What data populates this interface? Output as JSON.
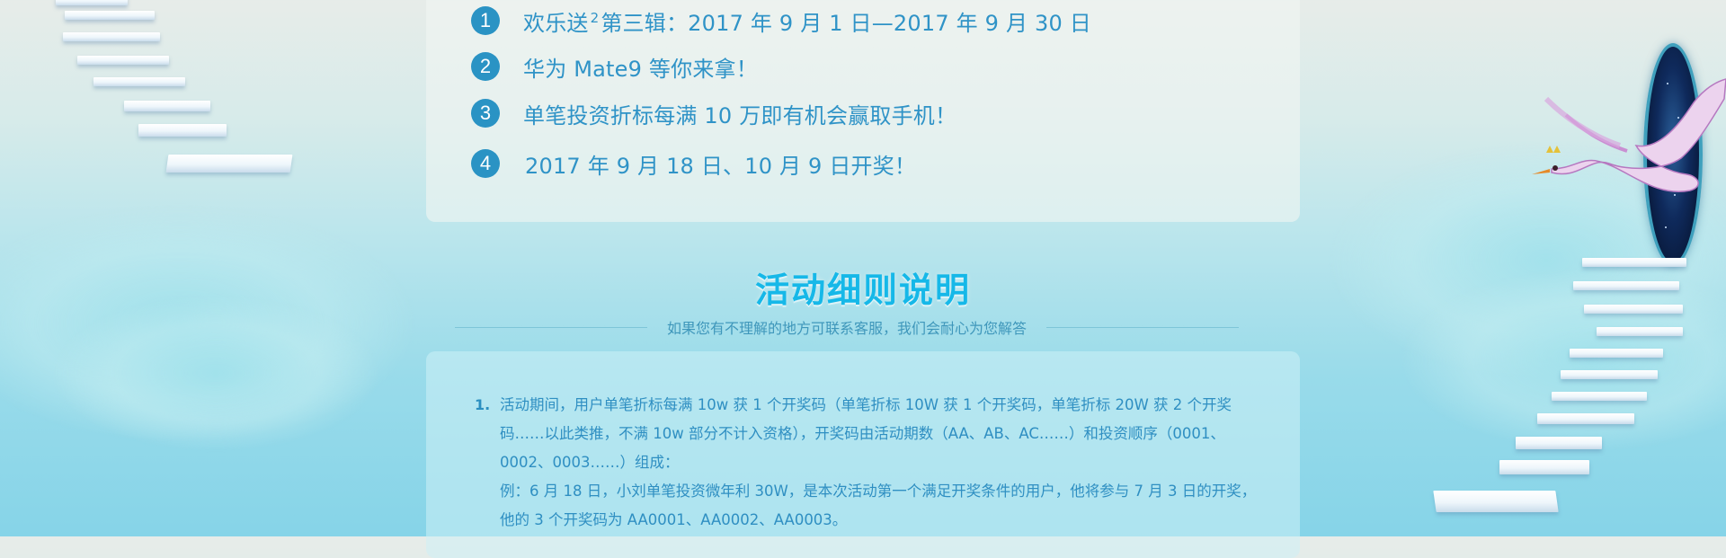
{
  "prizes": [
    {
      "num": "1",
      "text_before": "欢乐送",
      "sup": "2",
      "text_after": "第三辑：2017 年 9 月 1 日—2017 年 9 月 30 日"
    },
    {
      "num": "2",
      "text": "华为 Mate9 等你来拿！"
    },
    {
      "num": "3",
      "text": "单笔投资折标每满 10 万即有机会赢取手机！"
    },
    {
      "num": "4",
      "text": "2017 年 9 月 18 日、10 月 9 日开奖！"
    }
  ],
  "section": {
    "title": "活动细则说明",
    "subtitle": "如果您有不理解的地方可联系客服，我们会耐心为您解答"
  },
  "rules": [
    {
      "num": "1.",
      "text": "活动期间，用户单笔折标每满 10w 获 1 个开奖码（单笔折标 10W 获 1 个开奖码，单笔折标 20W 获 2 个开奖码……以此类推，不满 10w 部分不计入资格），开奖码由活动期数（AA、AB、AC……）和投资顺序（0001、0002、0003……）组成：",
      "example": "例：6 月 18 日，小刘单笔投资微年利 30W，是本次活动第一个满足开奖条件的用户，他将参与 7 月 3 日的开奖，他的 3 个开奖码为 AA0001、AA0002、AA0003。"
    }
  ],
  "colors": {
    "accent": "#2a93c4",
    "title": "#16b8e8",
    "text": "#2f93c7"
  }
}
